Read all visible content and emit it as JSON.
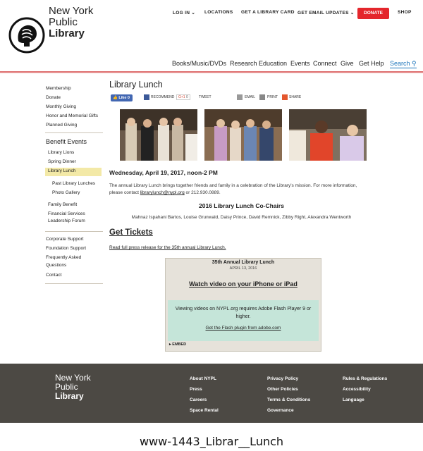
{
  "header": {
    "logo_lines": [
      "New York",
      "Public",
      "Library"
    ],
    "top_nav": [
      "LOG IN",
      "LOCATIONS",
      "GET A LIBRARY CARD",
      "GET EMAIL UPDATES",
      "DONATE",
      "SHOP"
    ],
    "main_nav": [
      "Books/Music/DVDs",
      "Research",
      "Education",
      "Events",
      "Connect",
      "Give",
      "Get Help",
      "Search"
    ]
  },
  "sidebar": {
    "group1": [
      "Membership",
      "Donate",
      "Monthly Giving",
      "Honor and Memorial Gifts",
      "Planned Giving"
    ],
    "heading": "Benefit Events",
    "events": [
      "Library Lions",
      "Spring Dinner",
      "Library Lunch"
    ],
    "sub_events": [
      "Past Library Lunches",
      "Photo Gallery"
    ],
    "events2": [
      "Family Benefit",
      "Financial Services",
      "Leadership Forum"
    ],
    "group3": [
      "Corporate Support",
      "Foundation Support",
      "Frequently Asked",
      "Questions",
      "Contact"
    ]
  },
  "main": {
    "title": "Library Lunch",
    "share": {
      "like": "Like 0",
      "recommend": "RECOMMEND",
      "gplus": "G+1",
      "gplus_count": "0",
      "tweet": "TWEET",
      "email": "EMAIL",
      "print": "PRINT",
      "share": "SHARE"
    },
    "date": "Wednesday, April 19, 2017, noon-2 PM",
    "desc1": "The annual Library Lunch brings together friends and family in a celebration of the Library's mission. For more information,",
    "desc2_pre": "please contact ",
    "desc2_link": "librarylunch@nypl.org",
    "desc2_post": " or 212.930.0889.",
    "cochairs_title": "2016 Library Lunch Co-Chairs",
    "cochairs_names": "Mahnaz Ispahani Bartos, Louise Grunwald, Daisy Prince, David Remnick, Zibby Right, Alexandra Wentworth",
    "tickets": "Get Tickets",
    "press_link": "Read full press release for the 35th annual Library Lunch.",
    "video": {
      "title": "35th Annual Library Lunch",
      "date": "APRIL 13, 2016",
      "watch": "Watch video on your iPhone or iPad",
      "flash_msg": "Viewing videos on NYPL.org requires Adobe Flash Player 9 or higher.",
      "flash_link": "Get the Flash plugin from adobe.com",
      "embed": "▸ EMBED"
    }
  },
  "footer": {
    "logo_lines": [
      "New York",
      "Public",
      "Library"
    ],
    "col1": [
      "About NYPL",
      "Press",
      "Careers",
      "Space Rental"
    ],
    "col2": [
      "Privacy Policy",
      "Other Policies",
      "Terms & Conditions",
      "Governance"
    ],
    "col3": [
      "Rules & Regulations",
      "Accessibility",
      "Language"
    ]
  },
  "caption": "www-1443_Librar__Lunch",
  "colors": {
    "accent_red": "#e4262c",
    "footer_bg": "#4c4944",
    "active_highlight": "#f3e9a7",
    "link_blue": "#1a73ba"
  }
}
